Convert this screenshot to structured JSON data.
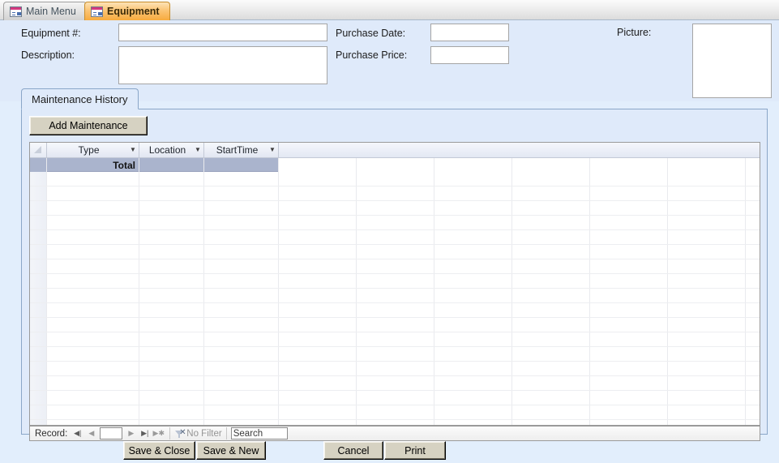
{
  "tabs": [
    {
      "label": "Main Menu",
      "icon": "form-icon",
      "active": false
    },
    {
      "label": "Equipment",
      "icon": "form-icon",
      "active": true
    }
  ],
  "header": {
    "fields": [
      {
        "label": "Equipment #:",
        "value": "",
        "name": "equipment-number"
      },
      {
        "label": "Description:",
        "value": "",
        "name": "description"
      },
      {
        "label": "Purchase Date:",
        "value": "",
        "name": "purchase-date"
      },
      {
        "label": "Purchase Price:",
        "value": "",
        "name": "purchase-price"
      }
    ],
    "picture_label": "Picture:"
  },
  "subform": {
    "tab_label": "Maintenance History",
    "add_button": "Add Maintenance",
    "datasheet": {
      "columns": [
        {
          "label": "Type",
          "sort_icon": "chevron-down-icon"
        },
        {
          "label": "Location",
          "sort_icon": "chevron-down-icon"
        },
        {
          "label": "StartTime",
          "sort_icon": "chevron-down-icon"
        }
      ],
      "total_row_label": "Total",
      "rows": []
    },
    "navigator": {
      "record_label": "Record:",
      "record_value": "",
      "first_icon": "first-record-icon",
      "prev_icon": "previous-record-icon",
      "next_icon": "next-record-icon",
      "last_icon": "last-record-icon",
      "new_icon": "new-record-icon",
      "filter_label": "No Filter",
      "filter_icon": "funnel-icon",
      "search_placeholder": "Search"
    }
  },
  "footer": {
    "buttons": [
      {
        "label": "Save & Close",
        "name": "save-and-close-button"
      },
      {
        "label": "Save & New",
        "name": "save-and-new-button"
      },
      {
        "label": "Cancel",
        "name": "cancel-button"
      },
      {
        "label": "Print",
        "name": "print-button"
      }
    ]
  },
  "colors": {
    "form_background": "#dfeafa",
    "active_tab": "#f7ab3e",
    "total_row": "#aab4cd",
    "button_face": "#d6d2c2"
  }
}
